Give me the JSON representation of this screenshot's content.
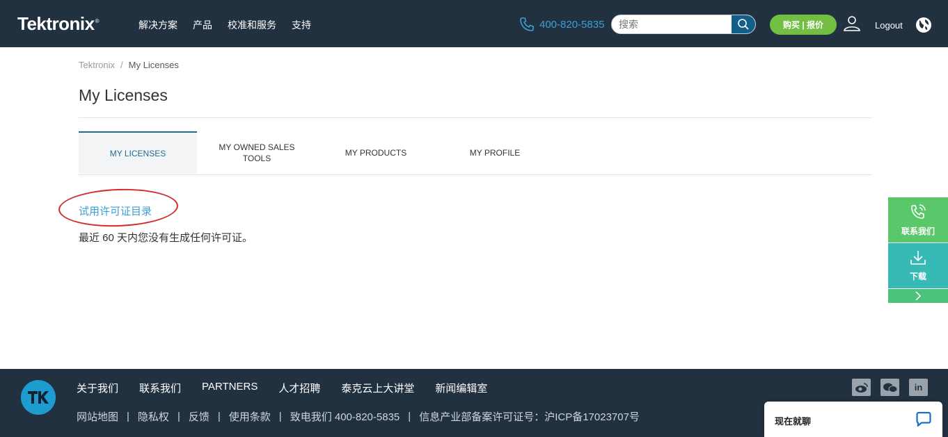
{
  "header": {
    "logo": "Tektronix",
    "logo_mark": "®",
    "nav": [
      "解决方案",
      "产品",
      "校准和服务",
      "支持"
    ],
    "phone": "400-820-5835",
    "search_placeholder": "搜索",
    "buy_label": "购买 | 报价",
    "logout_label": "Logout"
  },
  "breadcrumb": {
    "home": "Tektronix",
    "separator": "/",
    "current": "My Licenses"
  },
  "page_title": "My Licenses",
  "tabs": [
    {
      "label": "MY LICENSES",
      "active": true
    },
    {
      "label": "MY OWNED SALES TOOLS",
      "active": false
    },
    {
      "label": "MY PRODUCTS",
      "active": false
    },
    {
      "label": "MY PROFILE",
      "active": false
    }
  ],
  "content": {
    "trial_link": "试用许可证目录",
    "empty_message": "最近 60 天内您没有生成任何许可证。"
  },
  "side_widget": {
    "contact_label": "联系我们",
    "download_label": "下载"
  },
  "footer": {
    "links_row1": [
      "关于我们",
      "联系我们",
      "PARTNERS",
      "人才招聘",
      "泰克云上大讲堂",
      "新闻编辑室"
    ],
    "links_row2": [
      "网站地图",
      "隐私权",
      "反馈",
      "使用条款",
      "致电我们 400-820-5835"
    ],
    "separator": "|",
    "icp": "信息产业部备案许可证号：沪ICP备17023707号",
    "social": [
      "weibo-icon",
      "wechat-icon",
      "linkedin-icon"
    ],
    "linkedin_text": "in"
  },
  "chat": {
    "label": "现在就聊"
  },
  "colors": {
    "header_bg": "#223140",
    "accent_blue": "#3aa0d6",
    "buy_green": "#72bf44",
    "tab_active": "#1e6c93",
    "annotation_red": "#d42a2a"
  }
}
